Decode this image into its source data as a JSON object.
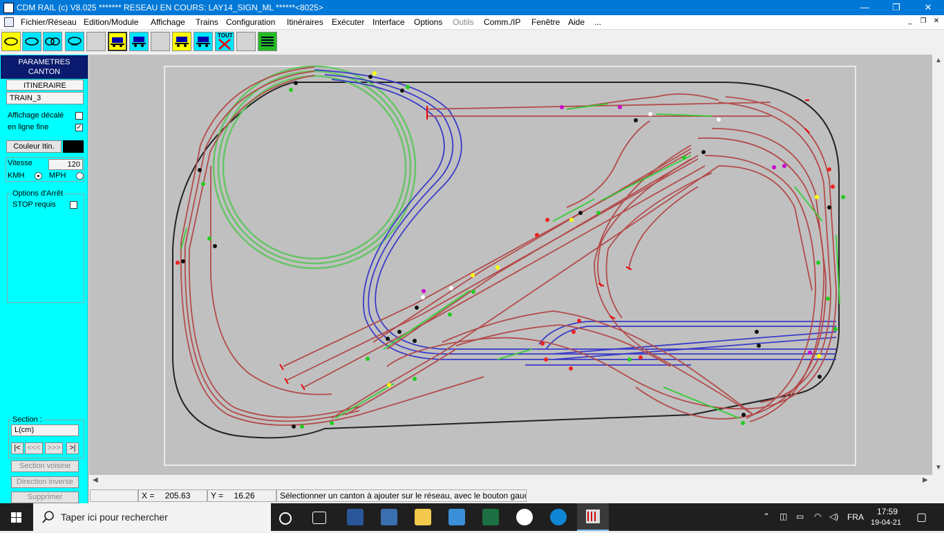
{
  "window": {
    "title": "CDM RAIL (c) V8.025      ******* RESEAU EN COURS: LAY14_SIGN_ML ******<8025>",
    "controls": {
      "minimize": "—",
      "maximize": "❐",
      "close": "✕"
    }
  },
  "menubar": {
    "items": [
      "Fichier/Réseau",
      "Edition/Module",
      "Affichage",
      "Trains",
      "Configuration",
      "Itinéraires",
      "Exécuter",
      "Interface",
      "Options",
      "Outils",
      "Comm./IP",
      "Fenêtre",
      "Aide",
      "..."
    ],
    "mdi": {
      "minimize": "_",
      "restore": "❐",
      "close": "✕"
    }
  },
  "toolbar": {
    "tout_label": "TOUT"
  },
  "left_panel": {
    "header_line1": "PARAMETRES",
    "header_line2": "CANTON",
    "itineraire_label": "ITINERAIRE",
    "itineraire_value": "TRAIN_3",
    "affichage_decale_label": "Affichage décalé",
    "en_ligne_fine_label": "en ligne fine",
    "en_ligne_fine_check": "✓",
    "couleur_button": "Couleur Itin.",
    "couleur_swatch": "#000000",
    "vitesse_label": "Vitesse",
    "vitesse_value": "120",
    "kmh_label": "KMH",
    "mph_label": "MPH",
    "options_arret_label": "Options d'Arrêt",
    "stop_requis_label": "STOP requis",
    "section_label": "Section :",
    "section_value": "L(cm)",
    "nav_first": "|<",
    "nav_prev": "<<<",
    "nav_next": ">>>",
    "nav_last": ">|",
    "section_voisine": "Section voisine",
    "direction_inverse": "Direction inverse",
    "supprimer": "Supprimer"
  },
  "status_bar": {
    "x_label": "X =",
    "x_value": "205.63",
    "y_label": "Y =",
    "y_value": "16.26",
    "message": "Sélectionner un canton à ajouter sur le réseau, avec le bouton gauc"
  },
  "taskbar": {
    "search_placeholder": "Taper ici pour rechercher",
    "language": "FRA",
    "time": "17:59",
    "date": "19-04-21"
  },
  "colors": {
    "panel": "#00ffff",
    "canvas": "#c0c0c0",
    "track_red": "#b34a4a",
    "track_blue": "#3a3ac8",
    "track_green": "#5fc25f",
    "track_black": "#222222",
    "route_green": "#33cc33"
  }
}
